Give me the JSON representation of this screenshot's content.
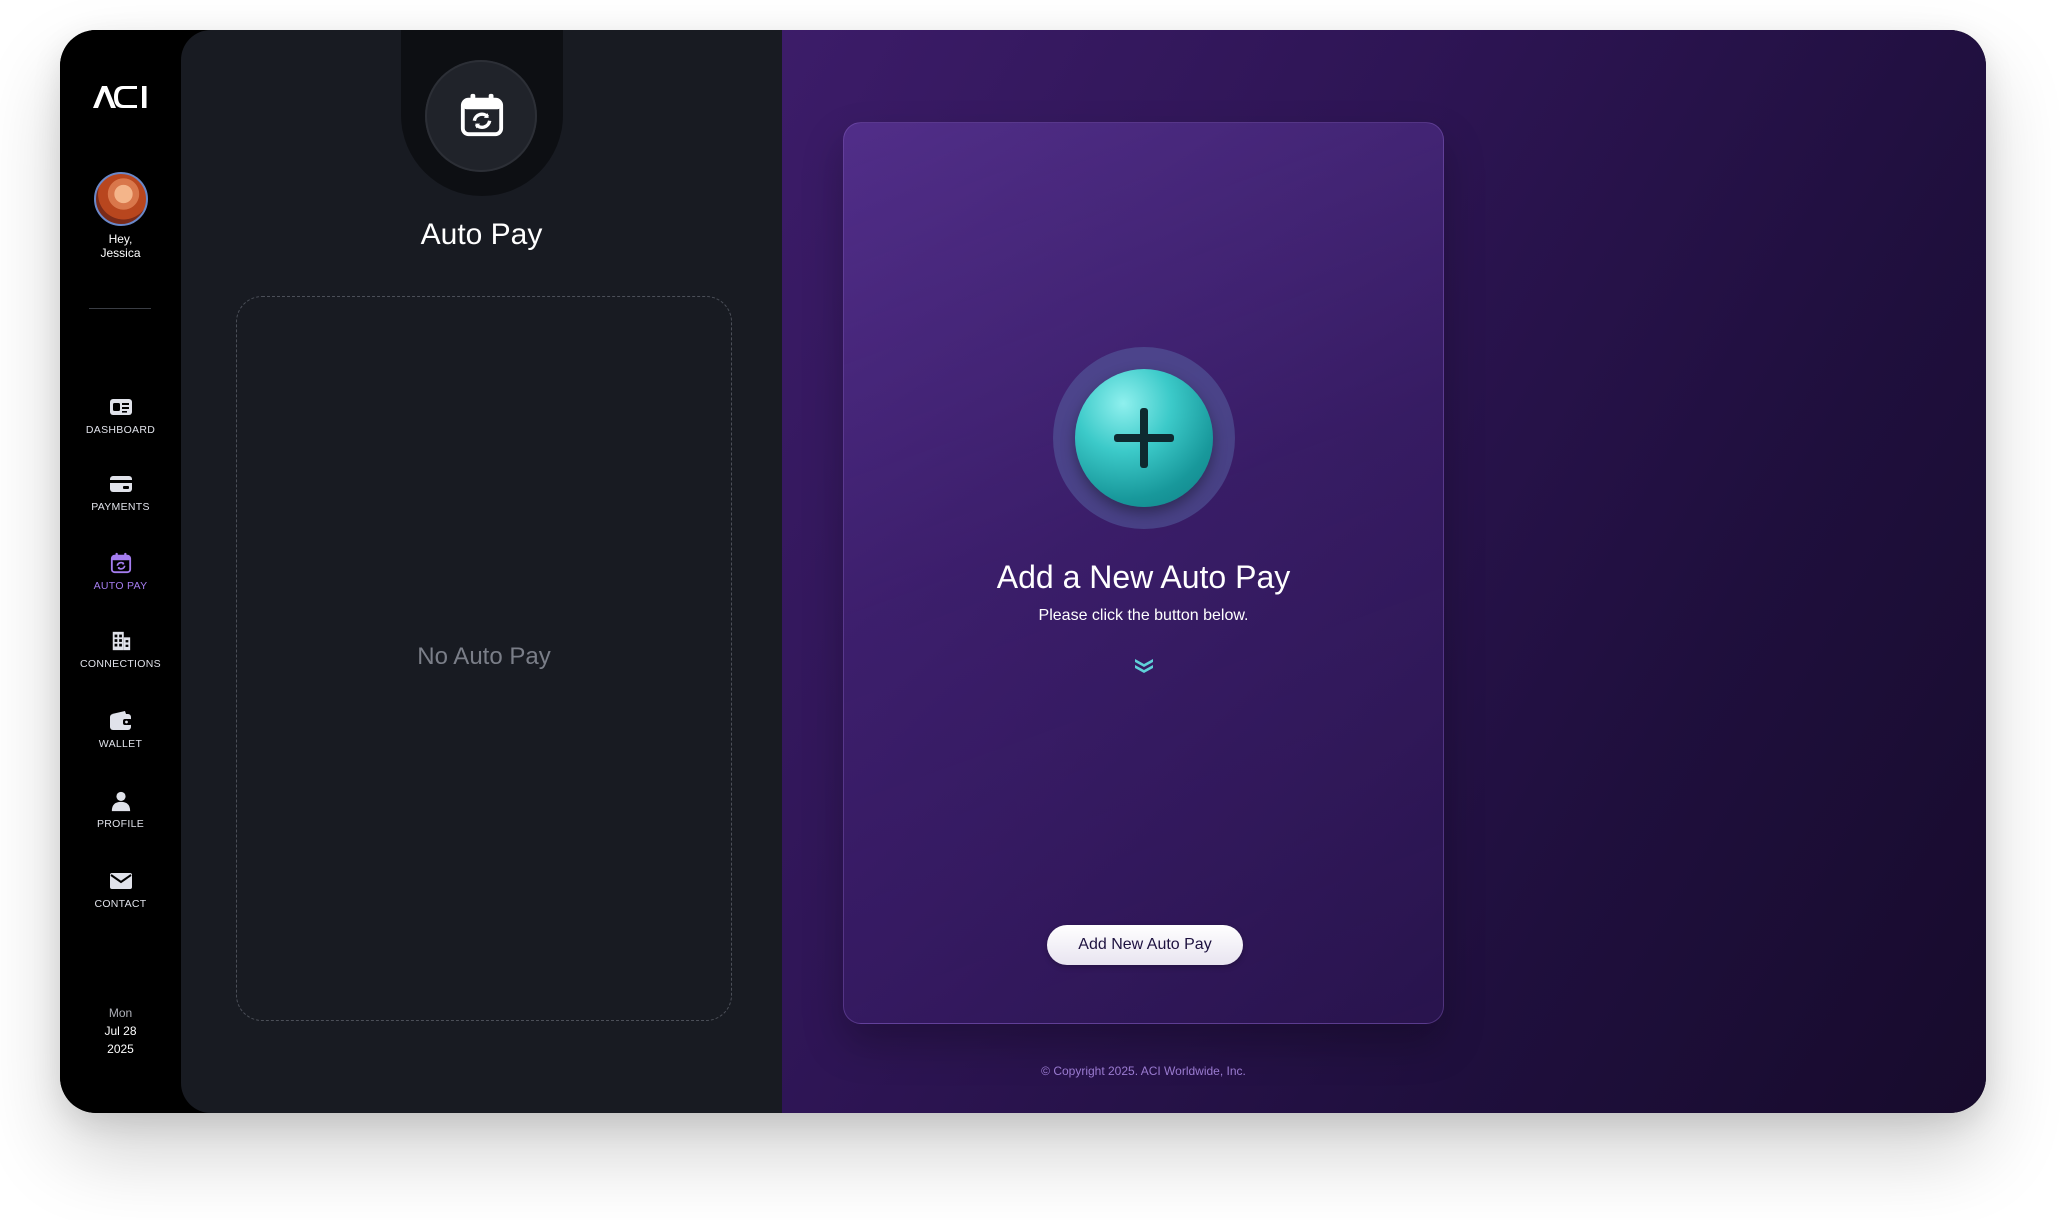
{
  "brand": {
    "logo_text": "ACI"
  },
  "user": {
    "greeting_line1": "Hey,",
    "greeting_line2": "Jessica"
  },
  "sidebar": {
    "items": [
      {
        "label": "DASHBOARD",
        "icon": "dashboard-card-icon"
      },
      {
        "label": "PAYMENTS",
        "icon": "credit-card-icon"
      },
      {
        "label": "AUTO PAY",
        "icon": "calendar-sync-icon",
        "active": true
      },
      {
        "label": "CONNECTIONS",
        "icon": "building-icon"
      },
      {
        "label": "WALLET",
        "icon": "wallet-icon"
      },
      {
        "label": "PROFILE",
        "icon": "person-icon"
      },
      {
        "label": "CONTACT",
        "icon": "envelope-icon"
      }
    ],
    "active_color": "#a57df0"
  },
  "date": {
    "weekday": "Mon",
    "month_day": "Jul 28",
    "year": "2025"
  },
  "autopay_panel": {
    "title": "Auto Pay",
    "icon": "calendar-sync-icon",
    "empty_text": "No Auto Pay"
  },
  "add_card": {
    "icon": "plus-icon",
    "title": "Add a New Auto Pay",
    "subtitle": "Please click the button below.",
    "hint_icon": "double-chevron-down-icon",
    "button_label": "Add New Auto Pay",
    "accent_color": "#3ccac9"
  },
  "footer": {
    "copyright": "© Copyright 2025. ACI Worldwide, Inc."
  }
}
